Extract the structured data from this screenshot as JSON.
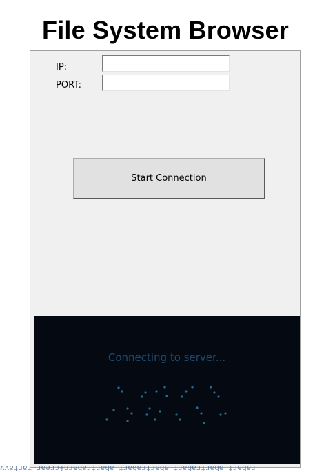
{
  "window": {
    "title": "File System Browser"
  },
  "form": {
    "ip_label": "IP:",
    "ip_value": "",
    "port_label": "PORT:",
    "port_value": ""
  },
  "actions": {
    "start_connection_label": "Start Connection"
  },
  "loader": {
    "status_text": "Connecting to server...",
    "background_color": "#050a12",
    "text_color": "#1a4a72",
    "dot_color": "#2b6a8f"
  }
}
